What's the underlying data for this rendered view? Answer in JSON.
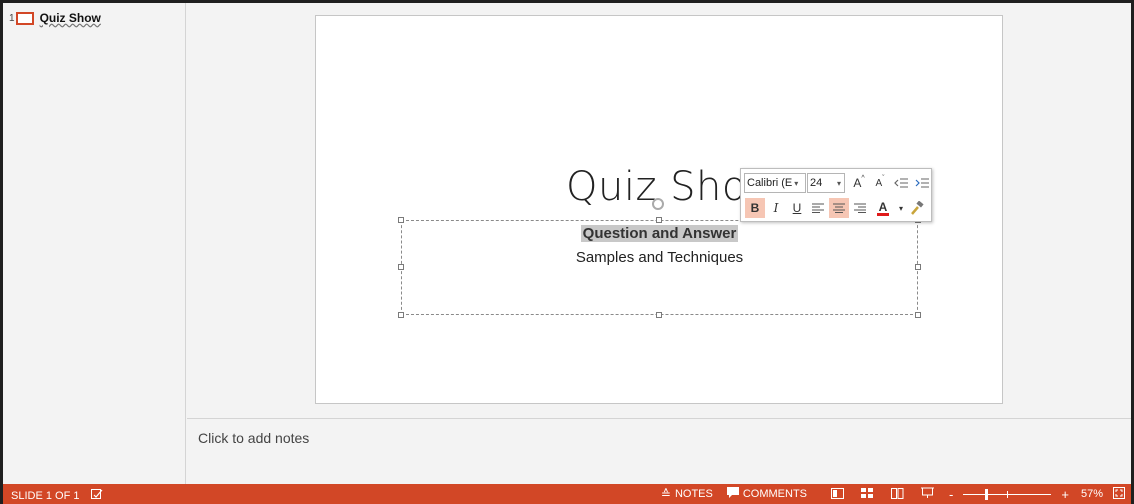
{
  "thumbnails": [
    {
      "number": "1",
      "title": "Quiz Show"
    }
  ],
  "slide": {
    "title": "Quiz Show",
    "subtitle_line1": "Question and Answer",
    "subtitle_line2": "Samples and Techniques"
  },
  "mini_toolbar": {
    "font_name": "Calibri (E",
    "font_size": "24",
    "buttons_row1": [
      "grow-font",
      "shrink-font",
      "decrease-indent",
      "increase-indent"
    ],
    "buttons_row2": {
      "bold": "B",
      "italic": "I",
      "underline": "U",
      "font_color": "A"
    },
    "active_buttons": [
      "bold",
      "align-center"
    ],
    "font_color_hex": "#e01b1b"
  },
  "notes": {
    "placeholder": "Click to add notes"
  },
  "status_bar": {
    "slide_indicator": "SLIDE 1 OF 1",
    "notes_label": "NOTES",
    "comments_label": "COMMENTS",
    "zoom_level": "57%",
    "zoom_value": 57,
    "zoom_min": 10,
    "zoom_max": 400,
    "accent_color": "#d24726"
  }
}
